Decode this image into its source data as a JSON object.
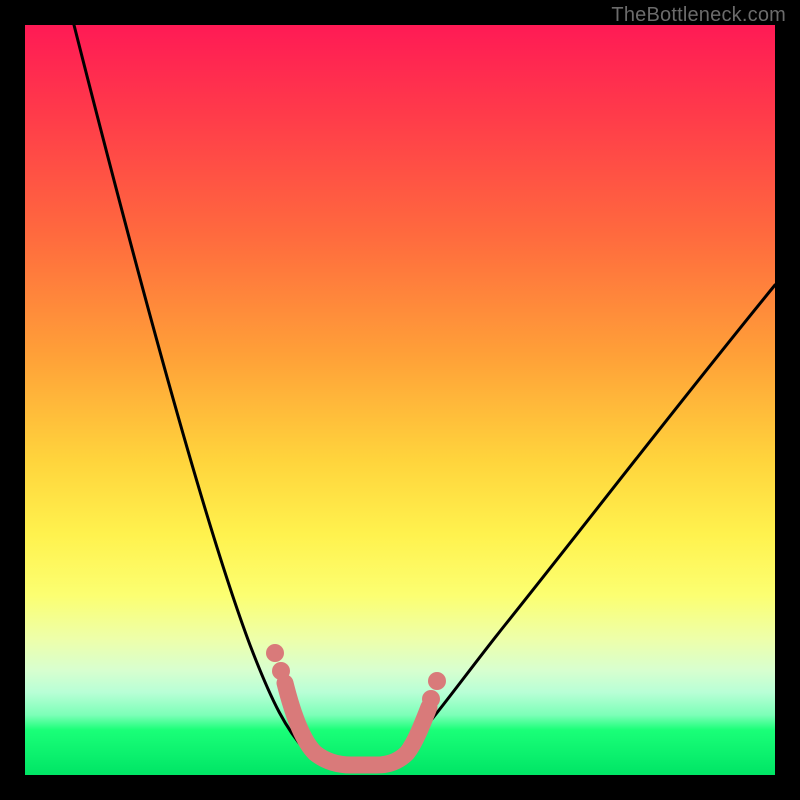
{
  "attribution": "TheBottleneck.com",
  "colors": {
    "frame": "#000000",
    "curve": "#000000",
    "marker": "#d97a7a",
    "attribution_text": "#6b6b6b",
    "gradient_stops": [
      "#ff1a55",
      "#ff3b4a",
      "#ff6a3e",
      "#ffa038",
      "#ffd43c",
      "#fff24e",
      "#fcff71",
      "#edffab",
      "#d8ffcf",
      "#b8ffd6",
      "#7cffb8",
      "#1aff78",
      "#00e565"
    ]
  },
  "chart_data": {
    "type": "line",
    "title": "",
    "xlabel": "",
    "ylabel": "",
    "series": [
      {
        "name": "left-branch",
        "x": [
          0.065,
          0.1,
          0.14,
          0.18,
          0.22,
          0.26,
          0.3,
          0.34,
          0.38,
          0.408
        ],
        "y": [
          1.0,
          0.78,
          0.6,
          0.46,
          0.34,
          0.24,
          0.16,
          0.09,
          0.04,
          0.016
        ]
      },
      {
        "name": "right-branch",
        "x": [
          0.47,
          0.52,
          0.58,
          0.65,
          0.73,
          0.82,
          0.91,
          1.0
        ],
        "y": [
          0.016,
          0.05,
          0.12,
          0.22,
          0.34,
          0.47,
          0.58,
          0.653
        ]
      }
    ],
    "markers": [
      {
        "name": "dot-left-upper",
        "x": 0.333,
        "y": 0.163
      },
      {
        "name": "dot-left-lower",
        "x": 0.341,
        "y": 0.139
      },
      {
        "name": "dot-right-upper",
        "x": 0.549,
        "y": 0.125
      },
      {
        "name": "dot-right-lower",
        "x": 0.541,
        "y": 0.101
      }
    ],
    "trough_band": {
      "x": [
        0.347,
        0.36,
        0.387,
        0.435,
        0.469,
        0.509,
        0.539
      ],
      "y": [
        0.123,
        0.045,
        0.016,
        0.013,
        0.016,
        0.045,
        0.091
      ]
    },
    "xlim": [
      0,
      1
    ],
    "ylim": [
      0,
      1
    ],
    "grid": false,
    "legend": false,
    "note": "Axes have no tick labels in the image; x and y are normalized 0–1 fractions of the plot area (x left→right, y bottom→top). Values are visual estimates."
  }
}
